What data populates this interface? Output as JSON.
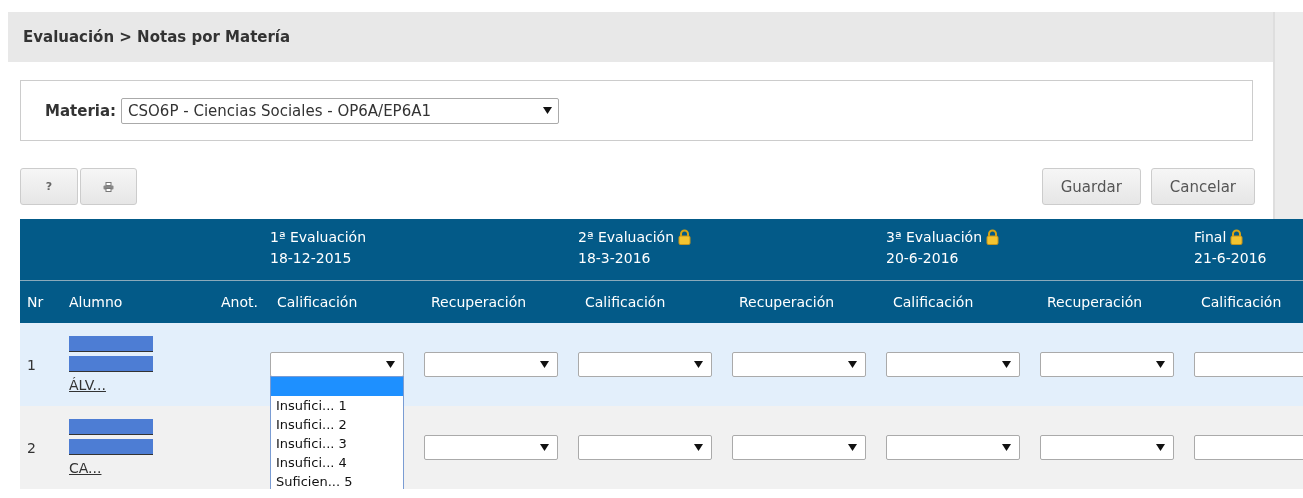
{
  "breadcrumb": "Evaluación > Notas por Matería",
  "subject": {
    "label": "Materia:",
    "value": "CSO6P - Ciencias Sociales - OP6A/EP6A1"
  },
  "tool_buttons": [
    {
      "kind": "help",
      "label": "?"
    },
    {
      "kind": "print"
    }
  ],
  "actions": [
    "Guardar",
    "Cancelar"
  ],
  "table": {
    "groups": [
      {
        "title": "1ª Evaluación",
        "date": "18-12-2015",
        "locked": false
      },
      {
        "title": "2ª Evaluación",
        "date": "18-3-2016",
        "locked": true
      },
      {
        "title": "3ª Evaluación",
        "date": "20-6-2016",
        "locked": true
      },
      {
        "title": "Final",
        "date": "21-6-2016",
        "locked": true
      }
    ],
    "columns": [
      "Nr",
      "Alumno",
      "Anot.",
      "Calificación",
      "Recuperación",
      "Calificación",
      "Recuperación",
      "Calificación",
      "Recuperación",
      "Calificación"
    ],
    "rows": [
      {
        "nr": "1",
        "highlighted": true,
        "name_lines": [
          {
            "redacted": true
          },
          {
            "redacted": true
          },
          {
            "text": "ÁLV...",
            "redacted": false
          }
        ],
        "cells": [
          {
            "kind": "select"
          },
          {
            "kind": "select"
          },
          {
            "kind": "select"
          },
          {
            "kind": "select"
          },
          {
            "kind": "select"
          },
          {
            "kind": "select"
          },
          {
            "kind": "cut_select"
          }
        ]
      },
      {
        "nr": "2",
        "highlighted": false,
        "name_lines": [
          {
            "redacted": true
          },
          {
            "redacted": true
          },
          {
            "text": "CA...",
            "redacted": false
          }
        ],
        "cells": [
          {
            "kind": "covered"
          },
          {
            "kind": "select"
          },
          {
            "kind": "select"
          },
          {
            "kind": "select"
          },
          {
            "kind": "select"
          },
          {
            "kind": "select"
          },
          {
            "kind": "cut_select"
          }
        ]
      }
    ],
    "open_dropdown": {
      "options": [
        {
          "selected": true
        },
        {
          "label": "Insufici... 1",
          "selected": false
        },
        {
          "label": "Insufici... 2",
          "selected": false
        },
        {
          "label": "Insufici... 3",
          "selected": false
        },
        {
          "label": "Insufici... 4",
          "selected": false
        },
        {
          "label": "Suficien... 5",
          "selected": false
        }
      ]
    }
  }
}
